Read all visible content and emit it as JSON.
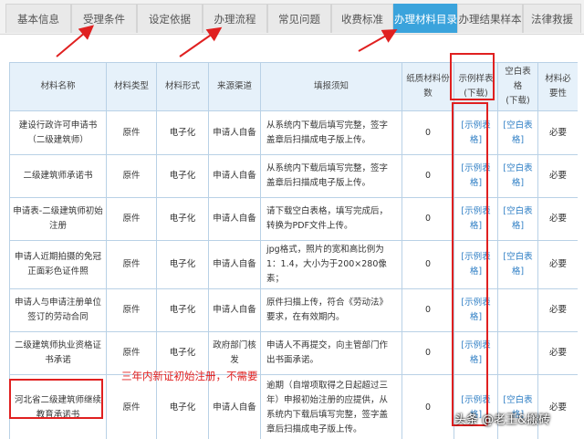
{
  "tabs": [
    {
      "label": "基本信息"
    },
    {
      "label": "受理条件"
    },
    {
      "label": "设定依据"
    },
    {
      "label": "办理流程"
    },
    {
      "label": "常见问题"
    },
    {
      "label": "收费标准"
    },
    {
      "label": "办理材料目录",
      "active": true
    },
    {
      "label": "办理结果样本"
    },
    {
      "label": "法律救援"
    }
  ],
  "table": {
    "headers": {
      "name": "材料名称",
      "type": "材料类型",
      "form": "材料形式",
      "source": "来源渠道",
      "notes": "填报须知",
      "paper_copies": "纸质材料份数",
      "sample_main": "示例样表",
      "sample_sub": "(下载)",
      "blank_main": "空白表格",
      "blank_sub": "(下载)",
      "necessity": "材料必要性"
    },
    "rows": [
      {
        "name": "建设行政许可申请书（二级建筑师）",
        "type": "原件",
        "form": "电子化",
        "source": "申请人自备",
        "notes": "从系统内下载后填写完整，签字盖章后扫描成电子版上传。",
        "copies": "0",
        "sample": "[示例表格]",
        "blank": "[空白表格]",
        "necessity": "必要"
      },
      {
        "name": "二级建筑师承诺书",
        "type": "原件",
        "form": "电子化",
        "source": "申请人自备",
        "notes": "从系统内下载后填写完整，签字盖章后扫描成电子版上传。",
        "copies": "0",
        "sample": "[示例表格]",
        "blank": "[空白表格]",
        "necessity": "必要"
      },
      {
        "name": "申请表-二级建筑师初始注册",
        "type": "原件",
        "form": "电子化",
        "source": "申请人自备",
        "notes": "请下载空白表格，填写完成后，转换为PDF文件上传。",
        "copies": "0",
        "sample": "[示例表格]",
        "blank": "[空白表格]",
        "necessity": "必要"
      },
      {
        "name": "申请人近期拍摄的免冠正面彩色证件照",
        "type": "原件",
        "form": "电子化",
        "source": "申请人自备",
        "notes": "jpg格式，照片的宽和高比例为1：1.4，大小为于200×280像素；",
        "copies": "0",
        "sample": "[示例表格]",
        "blank": "[空白表格]",
        "necessity": "必要"
      },
      {
        "name": "申请人与申请注册单位签订的劳动合同",
        "type": "原件",
        "form": "电子化",
        "source": "申请人自备",
        "notes": "原件扫描上传，符合《劳动法》要求，在有效期内。",
        "copies": "0",
        "sample": "[示例表格]",
        "blank": "",
        "necessity": "必要"
      },
      {
        "name": "二级建筑师执业资格证书承诺",
        "type": "原件",
        "form": "电子化",
        "source": "政府部门核发",
        "notes": "申请人不再提交，向主管部门作出书面承诺。",
        "copies": "0",
        "sample": "[示例表格]",
        "blank": "",
        "necessity": "必要"
      },
      {
        "name": "河北省二级建筑师继续教育承诺书",
        "type": "原件",
        "form": "电子化",
        "source": "申请人自备",
        "notes": "逾期（自增项取得之日起超过三年）申报初始注册的应提供，从系统内下载后填写完整，签字盖章后扫描成电子版上传。",
        "copies": "0",
        "sample": "[示例表格]",
        "blank": "[空白表格]",
        "necessity": "必要"
      }
    ]
  },
  "annotation": {
    "text": "三年内新证初始注册，不需要",
    "color": "#e02020"
  },
  "watermark": "头条 @老王&搬砖",
  "colors": {
    "active_tab": "#3aa3dc",
    "link": "#2f7fc5",
    "annotation_red": "#e02020",
    "header_bg": "#e6f1fa"
  }
}
